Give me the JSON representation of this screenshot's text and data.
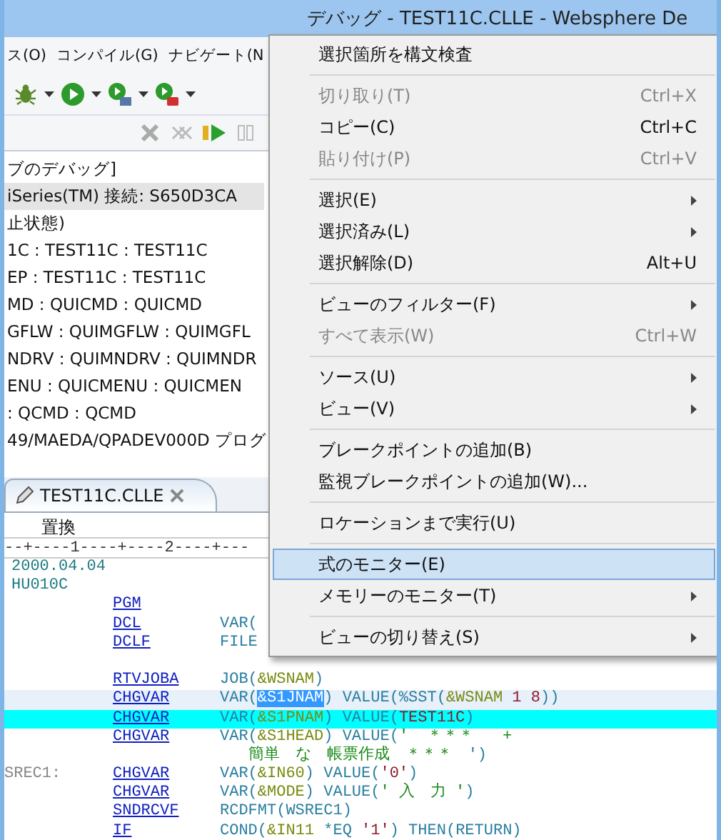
{
  "window": {
    "title": "デバッグ - TEST11C.CLLE - Websphere De"
  },
  "menubar": [
    {
      "label": "ス(O)"
    },
    {
      "label": "コンパイル(G)"
    },
    {
      "label": "ナビゲート(N"
    }
  ],
  "debug_tree": [
    {
      "label": "ブのデバッグ]",
      "selected": false
    },
    {
      "label": "iSeries(TM)   接続: S650D3CA",
      "selected": true
    },
    {
      "label": "止状態)",
      "selected": false
    },
    {
      "label": "1C : TEST11C : TEST11C",
      "selected": false
    },
    {
      "label": "EP : TEST11C : TEST11C",
      "selected": false
    },
    {
      "label": "MD : QUICMD : QUICMD",
      "selected": false
    },
    {
      "label": "GFLW : QUIMGFLW : QUIMGFL",
      "selected": false
    },
    {
      "label": "NDRV : QUIMNDRV : QUIMNDR",
      "selected": false
    },
    {
      "label": "ENU : QUICMENU : QUICMEN",
      "selected": false
    },
    {
      "label": ": QCMD : QCMD",
      "selected": false
    },
    {
      "label": "49/MAEDA/QPADEV000D  プログ",
      "selected": false
    }
  ],
  "editor": {
    "tab": "TEST11C.CLLE",
    "mode": "置換",
    "ruler": "--+----1----+----2----+---",
    "lines": [
      {
        "label": "2000.04.04",
        "current": false,
        "executing": false
      },
      {
        "label": "HU010C",
        "current": false,
        "executing": false
      },
      {
        "opcode": "PGM",
        "current": false,
        "executing": false
      },
      {
        "opcode": "DCL",
        "current": false,
        "executing": false,
        "params": [
          {
            "text": "VAR(",
            "kind": "k"
          }
        ]
      },
      {
        "opcode": "DCLF",
        "current": false,
        "executing": false,
        "params": [
          {
            "text": "FILE",
            "kind": "k"
          }
        ]
      },
      {
        "current": false,
        "executing": false
      },
      {
        "opcode": "RTVJOBA",
        "current": false,
        "executing": false,
        "params": [
          {
            "text": "JOB(",
            "kind": "k"
          },
          {
            "text": "&WSNAM",
            "kind": "v"
          },
          {
            "text": ")",
            "kind": "k"
          }
        ]
      },
      {
        "opcode": "CHGVAR",
        "current": true,
        "executing": false,
        "params": [
          {
            "text": "VAR(",
            "kind": "k"
          },
          {
            "text": "&S1JNAM",
            "kind": "sel"
          },
          {
            "text": ") VALUE(%SST(",
            "kind": "k"
          },
          {
            "text": "&WSNAM",
            "kind": "v"
          },
          {
            "text": " 1 8",
            "kind": "l"
          },
          {
            "text": "))",
            "kind": "k"
          }
        ]
      },
      {
        "opcode": "CHGVAR",
        "current": false,
        "executing": true,
        "params": [
          {
            "text": "VAR(",
            "kind": "k"
          },
          {
            "text": "&S1PNAM",
            "kind": "v"
          },
          {
            "text": ") VALUE(",
            "kind": "k"
          },
          {
            "text": "TEST11C",
            "kind": "l"
          },
          {
            "text": ")",
            "kind": "k"
          }
        ]
      },
      {
        "opcode": "CHGVAR",
        "current": false,
        "executing": false,
        "params": [
          {
            "text": "VAR(",
            "kind": "k"
          },
          {
            "text": "&S1HEAD",
            "kind": "v"
          },
          {
            "text": ") VALUE(",
            "kind": "k"
          },
          {
            "text": "'  ＊＊＊   +",
            "kind": "s"
          }
        ]
      },
      {
        "current": false,
        "executing": false,
        "params": [
          {
            "text": "   簡単　な　帳票作成　＊＊＊　",
            "kind": "s"
          },
          {
            "text": "')",
            "kind": "k"
          }
        ]
      },
      {
        "label": "SREC1:",
        "opcode": "CHGVAR",
        "current": false,
        "executing": false,
        "params": [
          {
            "text": "VAR(",
            "kind": "k"
          },
          {
            "text": "&IN60",
            "kind": "v"
          },
          {
            "text": ") VALUE(",
            "kind": "k"
          },
          {
            "text": "'0'",
            "kind": "l"
          },
          {
            "text": ")",
            "kind": "k"
          }
        ]
      },
      {
        "opcode": "CHGVAR",
        "current": false,
        "executing": false,
        "params": [
          {
            "text": "VAR(",
            "kind": "k"
          },
          {
            "text": "&MODE",
            "kind": "v"
          },
          {
            "text": ") VALUE(",
            "kind": "k"
          },
          {
            "text": "' 入　力 '",
            "kind": "s"
          },
          {
            "text": ")",
            "kind": "k"
          }
        ]
      },
      {
        "opcode": "SNDRCVF",
        "current": false,
        "executing": false,
        "params": [
          {
            "text": "RCDFMT(WSREC1)",
            "kind": "k"
          }
        ]
      },
      {
        "opcode": "IF",
        "current": false,
        "executing": false,
        "params": [
          {
            "text": "COND(",
            "kind": "k"
          },
          {
            "text": "&IN11",
            "kind": "v"
          },
          {
            "text": " *EQ ",
            "kind": "k"
          },
          {
            "text": "'1'",
            "kind": "l"
          },
          {
            "text": ") THEN(RETURN)",
            "kind": "k"
          }
        ]
      }
    ]
  },
  "context_menu": [
    {
      "kind": "item",
      "label": "選択箇所を構文検査",
      "disabled": false,
      "submenu": false,
      "selected": false
    },
    {
      "kind": "separator"
    },
    {
      "kind": "item",
      "label": "切り取り(T)",
      "shortcut": "Ctrl+X",
      "disabled": true,
      "submenu": false,
      "selected": false
    },
    {
      "kind": "item",
      "label": "コピー(C)",
      "shortcut": "Ctrl+C",
      "disabled": false,
      "submenu": false,
      "selected": false
    },
    {
      "kind": "item",
      "label": "貼り付け(P)",
      "shortcut": "Ctrl+V",
      "disabled": true,
      "submenu": false,
      "selected": false
    },
    {
      "kind": "separator"
    },
    {
      "kind": "item",
      "label": "選択(E)",
      "disabled": false,
      "submenu": true,
      "selected": false
    },
    {
      "kind": "item",
      "label": "選択済み(L)",
      "disabled": false,
      "submenu": true,
      "selected": false
    },
    {
      "kind": "item",
      "label": "選択解除(D)",
      "shortcut": "Alt+U",
      "disabled": false,
      "submenu": false,
      "selected": false
    },
    {
      "kind": "separator"
    },
    {
      "kind": "item",
      "label": "ビューのフィルター(F)",
      "disabled": false,
      "submenu": true,
      "selected": false
    },
    {
      "kind": "item",
      "label": "すべて表示(W)",
      "shortcut": "Ctrl+W",
      "disabled": true,
      "submenu": false,
      "selected": false
    },
    {
      "kind": "separator"
    },
    {
      "kind": "item",
      "label": "ソース(U)",
      "disabled": false,
      "submenu": true,
      "selected": false
    },
    {
      "kind": "item",
      "label": "ビュー(V)",
      "disabled": false,
      "submenu": true,
      "selected": false
    },
    {
      "kind": "separator"
    },
    {
      "kind": "item",
      "label": "ブレークポイントの追加(B)",
      "disabled": false,
      "submenu": false,
      "selected": false
    },
    {
      "kind": "item",
      "label": "監視ブレークポイントの追加(W)...",
      "disabled": false,
      "submenu": false,
      "selected": false
    },
    {
      "kind": "separator"
    },
    {
      "kind": "item",
      "label": "ロケーションまで実行(U)",
      "disabled": false,
      "submenu": false,
      "selected": false
    },
    {
      "kind": "separator"
    },
    {
      "kind": "item",
      "label": "式のモニター(E)",
      "disabled": false,
      "submenu": false,
      "selected": true
    },
    {
      "kind": "item",
      "label": "メモリーのモニター(T)",
      "disabled": false,
      "submenu": true,
      "selected": false
    },
    {
      "kind": "separator"
    },
    {
      "kind": "item",
      "label": "ビューの切り替え(S)",
      "disabled": false,
      "submenu": true,
      "selected": false
    }
  ]
}
